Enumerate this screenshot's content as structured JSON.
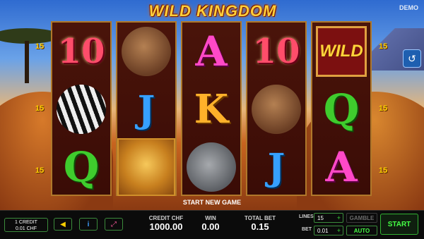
{
  "header": {
    "title": "WILD KINGDOM",
    "mode_badge": "DEMO"
  },
  "colors": {
    "accent_gold": "#ffcf3a",
    "panel_green": "#3b8b3b",
    "start_green": "#45ff45"
  },
  "line_numbers": {
    "left": [
      "15",
      "15",
      "15"
    ],
    "right": [
      "15",
      "15",
      "15"
    ]
  },
  "reels": [
    [
      "10",
      "zebra",
      "Q"
    ],
    [
      "warthog",
      "J",
      "lion"
    ],
    [
      "A",
      "K",
      "rhino"
    ],
    [
      "10",
      "warthog",
      "J"
    ],
    [
      "WILD",
      "Q",
      "A"
    ]
  ],
  "side_button": {
    "icon": "history-icon"
  },
  "status_text": "START NEW GAME",
  "footer": {
    "credit_rate_line1": "1 CREDIT",
    "credit_rate_line2": "0.01 CHF",
    "credit_label": "CREDIT",
    "currency": "CHF",
    "credit_value": "1000.00",
    "win_label": "WIN",
    "win_value": "0.00",
    "total_bet_label": "TOTAL BET",
    "total_bet_value": "0.15",
    "lines_label": "LINES",
    "lines_value": "15",
    "bet_label": "BET",
    "bet_value": "0.01",
    "plus_symbol": "+",
    "gamble_label": "GAMBLE",
    "auto_label": "AUTO",
    "start_label": "START",
    "sound_icon": "speaker-icon",
    "info_icon": "info-icon",
    "fullscreen_icon": "fullscreen-icon"
  }
}
